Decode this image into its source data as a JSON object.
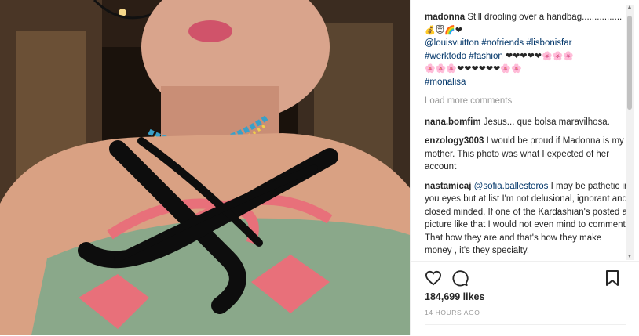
{
  "caption": {
    "username": "madonna",
    "text": "Still drooling over a handbag................",
    "emojis": "💰😇🌈❤",
    "hashtags_line1": "@louisvuitton #nofriends #lisbonisfar",
    "hashtags_line2": "#werktodo #fashion",
    "emojis_line2": "❤❤❤❤❤🌸🌸🌸",
    "emojis_line3": "🌸🌸🌸❤❤❤❤❤❤🌸🌸",
    "hashtags_line3": "#monalisa"
  },
  "load_more": "Load more comments",
  "comments": [
    {
      "username": "nana.bomfim",
      "text": "Jesus... que bolsa maravilhosa."
    },
    {
      "username": "enzology3003",
      "text": "I would be proud if Madonna is my mother. This photo was what I expected of her account"
    },
    {
      "username": "nastamicaj",
      "mention": "@sofia.ballesteros",
      "text": " I may be pathetic in you eyes but at list I'm not delusional, ignorant and closed minded. If one of the Kardashian's posted a picture like that I would not even mind to comment. That how they are and that's how they make money , it's they specialty."
    }
  ],
  "likes": "184,699 likes",
  "timestamp": "14 HOURS AGO",
  "icons": [
    "heart-icon",
    "comment-icon",
    "bookmark-icon"
  ],
  "colors": {
    "hashtag": "#003569",
    "muted": "#999999",
    "bag_pink": "#e8707a"
  }
}
